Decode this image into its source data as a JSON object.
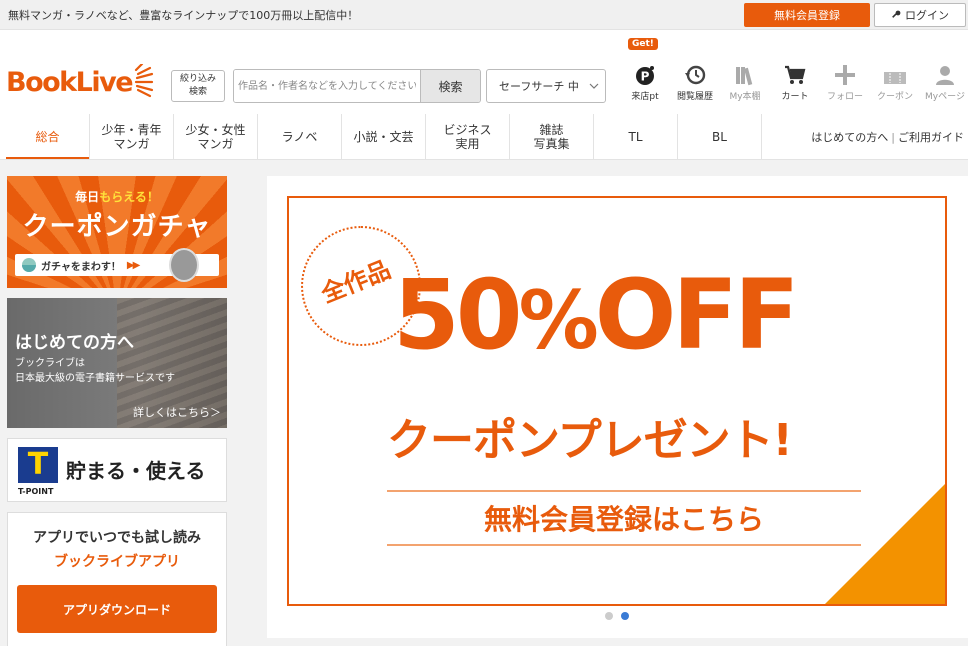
{
  "topbar": {
    "message": "無料マンガ・ラノベなど、豊富なラインナップで100万冊以上配信中！",
    "register_label": "無料会員登録",
    "login_label": "ログイン"
  },
  "header": {
    "logo_text": "BookLive",
    "filter_line1": "絞り込み",
    "filter_line2": "検索",
    "search_placeholder": "作品名・作者名などを入力してください",
    "search_button": "検索",
    "safe_search": "セーフサーチ 中",
    "get_badge": "Get!",
    "icons": [
      {
        "label": "来店pt",
        "icon": "point-icon"
      },
      {
        "label": "閲覧履歴",
        "icon": "history-icon"
      },
      {
        "label": "My本棚",
        "icon": "bookshelf-icon"
      },
      {
        "label": "カート",
        "icon": "cart-icon"
      },
      {
        "label": "フォロー",
        "icon": "plus-icon"
      },
      {
        "label": "クーポン",
        "icon": "coupon-icon"
      },
      {
        "label": "Myページ",
        "icon": "user-icon"
      }
    ]
  },
  "nav": {
    "items": [
      {
        "label": "総合"
      },
      {
        "label": "少年・青年\nマンガ"
      },
      {
        "label": "少女・女性\nマンガ"
      },
      {
        "label": "ラノベ"
      },
      {
        "label": "小説・文芸"
      },
      {
        "label": "ビジネス\n実用"
      },
      {
        "label": "雑誌\n写真集"
      },
      {
        "label": "TL"
      },
      {
        "label": "BL"
      }
    ],
    "guide_first": "はじめての方へ",
    "guide_usage": "ご利用ガイド"
  },
  "sidebar": {
    "gacha": {
      "daily_prefix": "毎日",
      "daily_highlight": "もらえる！",
      "title": "クーポンガチャ",
      "pill": "ガチャをまわす！",
      "arrows": "▶▶"
    },
    "hajime": {
      "title": "はじめての方へ",
      "sub1": "ブックライブは",
      "sub2": "日本最大級の電子書籍サービスです",
      "more": "詳しくはこちら＞"
    },
    "tpoint": {
      "logo_letter": "T",
      "logo_label": "T-POINT",
      "text": "貯まる・使える"
    },
    "app": {
      "line1": "アプリでいつでも試し読み",
      "line2": "ブックライブアプリ",
      "download": "アプリダウンロード"
    }
  },
  "hero": {
    "all_works": "全作品",
    "off_number": "50",
    "off_pct": "%",
    "off_word": "OFF",
    "present": "クーポンプレゼント!",
    "register": "無料会員登録はこちら",
    "slide_count": 2,
    "active_slide": 2
  },
  "colors": {
    "brand": "#e85b0c",
    "accent": "#f39200",
    "active_dot": "#3a7bd5"
  }
}
